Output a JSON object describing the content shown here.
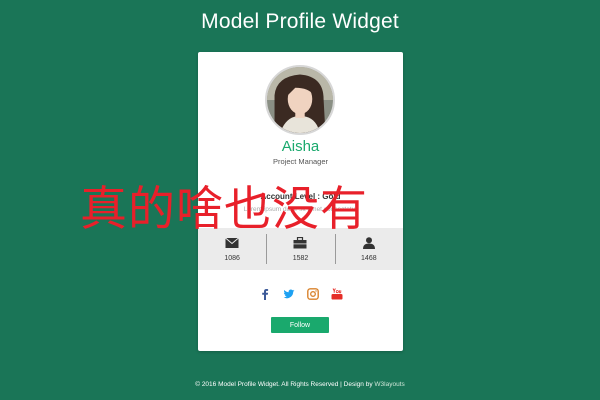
{
  "page": {
    "title": "Model Profile Widget"
  },
  "profile": {
    "name": "Aisha",
    "role": "Project Manager",
    "level": "Account Level : Gold",
    "description": "Lorem ipsum dolor sit amet consectetur"
  },
  "stats": [
    {
      "icon": "envelope-icon",
      "value": "1086"
    },
    {
      "icon": "briefcase-icon",
      "value": "1582"
    },
    {
      "icon": "user-icon",
      "value": "1468"
    }
  ],
  "social": [
    {
      "icon": "facebook-icon",
      "color": "#3b5998"
    },
    {
      "icon": "twitter-icon",
      "color": "#1da1f2"
    },
    {
      "icon": "instagram-icon",
      "color": "#d9822b"
    },
    {
      "icon": "youtube-icon",
      "color": "#e52d27"
    }
  ],
  "follow_label": "Follow",
  "watermark": "真的啥也没有",
  "footer": {
    "text": "© 2016 Model Profile Widget. All Rights Reserved | Design by ",
    "link": "W3layouts"
  },
  "colors": {
    "background": "#1a7557",
    "accent": "#1aa96d",
    "watermark": "#e8202a"
  }
}
